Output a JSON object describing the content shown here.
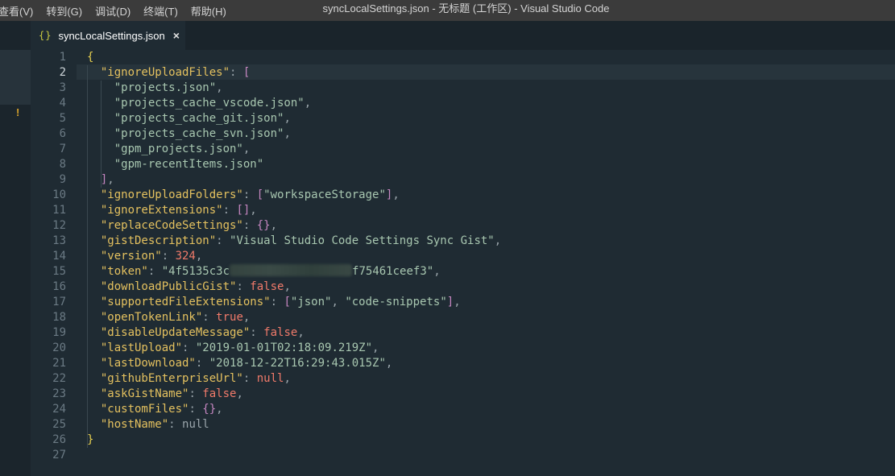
{
  "menu": [
    "查看(V)",
    "转到(G)",
    "调试(D)",
    "终端(T)",
    "帮助(H)"
  ],
  "window_title": "syncLocalSettings.json - 无标题 (工作区) - Visual Studio Code",
  "tab": {
    "icon": "{}",
    "label": "syncLocalSettings.json",
    "close": "×"
  },
  "sidebar": {
    "warning": "!"
  },
  "editor": {
    "active_line": 2,
    "lines": [
      {
        "num": "1",
        "tokens": [
          {
            "t": "{",
            "c": "y"
          }
        ]
      },
      {
        "num": "2",
        "tokens": [
          {
            "t": "  "
          },
          {
            "t": "\"ignoreUploadFiles\"",
            "c": "k"
          },
          {
            "t": ": ",
            "c": "p"
          },
          {
            "t": "[",
            "c": "b"
          }
        ]
      },
      {
        "num": "3",
        "tokens": [
          {
            "t": "    "
          },
          {
            "t": "\"projects.json\"",
            "c": "s"
          },
          {
            "t": ",",
            "c": "p"
          }
        ]
      },
      {
        "num": "4",
        "tokens": [
          {
            "t": "    "
          },
          {
            "t": "\"projects_cache_vscode.json\"",
            "c": "s"
          },
          {
            "t": ",",
            "c": "p"
          }
        ]
      },
      {
        "num": "5",
        "tokens": [
          {
            "t": "    "
          },
          {
            "t": "\"projects_cache_git.json\"",
            "c": "s"
          },
          {
            "t": ",",
            "c": "p"
          }
        ]
      },
      {
        "num": "6",
        "tokens": [
          {
            "t": "    "
          },
          {
            "t": "\"projects_cache_svn.json\"",
            "c": "s"
          },
          {
            "t": ",",
            "c": "p"
          }
        ]
      },
      {
        "num": "7",
        "tokens": [
          {
            "t": "    "
          },
          {
            "t": "\"gpm_projects.json\"",
            "c": "s"
          },
          {
            "t": ",",
            "c": "p"
          }
        ]
      },
      {
        "num": "8",
        "tokens": [
          {
            "t": "    "
          },
          {
            "t": "\"gpm-recentItems.json\"",
            "c": "s"
          }
        ]
      },
      {
        "num": "9",
        "tokens": [
          {
            "t": "  "
          },
          {
            "t": "]",
            "c": "b"
          },
          {
            "t": ",",
            "c": "p"
          }
        ]
      },
      {
        "num": "10",
        "tokens": [
          {
            "t": "  "
          },
          {
            "t": "\"ignoreUploadFolders\"",
            "c": "k"
          },
          {
            "t": ": ",
            "c": "p"
          },
          {
            "t": "[",
            "c": "b"
          },
          {
            "t": "\"workspaceStorage\"",
            "c": "s"
          },
          {
            "t": "]",
            "c": "b"
          },
          {
            "t": ",",
            "c": "p"
          }
        ]
      },
      {
        "num": "11",
        "tokens": [
          {
            "t": "  "
          },
          {
            "t": "\"ignoreExtensions\"",
            "c": "k"
          },
          {
            "t": ": ",
            "c": "p"
          },
          {
            "t": "[]",
            "c": "b"
          },
          {
            "t": ",",
            "c": "p"
          }
        ]
      },
      {
        "num": "12",
        "tokens": [
          {
            "t": "  "
          },
          {
            "t": "\"replaceCodeSettings\"",
            "c": "k"
          },
          {
            "t": ": ",
            "c": "p"
          },
          {
            "t": "{}",
            "c": "b"
          },
          {
            "t": ",",
            "c": "p"
          }
        ]
      },
      {
        "num": "13",
        "tokens": [
          {
            "t": "  "
          },
          {
            "t": "\"gistDescription\"",
            "c": "k"
          },
          {
            "t": ": ",
            "c": "p"
          },
          {
            "t": "\"Visual Studio Code Settings Sync Gist\"",
            "c": "s"
          },
          {
            "t": ",",
            "c": "p"
          }
        ]
      },
      {
        "num": "14",
        "tokens": [
          {
            "t": "  "
          },
          {
            "t": "\"version\"",
            "c": "k"
          },
          {
            "t": ": ",
            "c": "p"
          },
          {
            "t": "324",
            "c": "n"
          },
          {
            "t": ",",
            "c": "p"
          }
        ]
      },
      {
        "num": "15",
        "tokens": [
          {
            "t": "  "
          },
          {
            "t": "\"token\"",
            "c": "k"
          },
          {
            "t": ": ",
            "c": "p"
          },
          {
            "t": "\"4f5135c3c",
            "c": "s"
          },
          {
            "t": "",
            "blur": true
          },
          {
            "t": "f75461ceef3\"",
            "c": "s"
          },
          {
            "t": ",",
            "c": "p"
          }
        ]
      },
      {
        "num": "16",
        "tokens": [
          {
            "t": "  "
          },
          {
            "t": "\"downloadPublicGist\"",
            "c": "k"
          },
          {
            "t": ": ",
            "c": "p"
          },
          {
            "t": "false",
            "c": "n"
          },
          {
            "t": ",",
            "c": "p"
          }
        ]
      },
      {
        "num": "17",
        "tokens": [
          {
            "t": "  "
          },
          {
            "t": "\"supportedFileExtensions\"",
            "c": "k"
          },
          {
            "t": ": ",
            "c": "p"
          },
          {
            "t": "[",
            "c": "b"
          },
          {
            "t": "\"json\"",
            "c": "s"
          },
          {
            "t": ", ",
            "c": "p"
          },
          {
            "t": "\"code-snippets\"",
            "c": "s"
          },
          {
            "t": "]",
            "c": "b"
          },
          {
            "t": ",",
            "c": "p"
          }
        ]
      },
      {
        "num": "18",
        "tokens": [
          {
            "t": "  "
          },
          {
            "t": "\"openTokenLink\"",
            "c": "k"
          },
          {
            "t": ": ",
            "c": "p"
          },
          {
            "t": "true",
            "c": "n"
          },
          {
            "t": ",",
            "c": "p"
          }
        ]
      },
      {
        "num": "19",
        "tokens": [
          {
            "t": "  "
          },
          {
            "t": "\"disableUpdateMessage\"",
            "c": "k"
          },
          {
            "t": ": ",
            "c": "p"
          },
          {
            "t": "false",
            "c": "n"
          },
          {
            "t": ",",
            "c": "p"
          }
        ]
      },
      {
        "num": "20",
        "tokens": [
          {
            "t": "  "
          },
          {
            "t": "\"lastUpload\"",
            "c": "k"
          },
          {
            "t": ": ",
            "c": "p"
          },
          {
            "t": "\"2019-01-01T02:18:09.219Z\"",
            "c": "s"
          },
          {
            "t": ",",
            "c": "p"
          }
        ]
      },
      {
        "num": "21",
        "tokens": [
          {
            "t": "  "
          },
          {
            "t": "\"lastDownload\"",
            "c": "k"
          },
          {
            "t": ": ",
            "c": "p"
          },
          {
            "t": "\"2018-12-22T16:29:43.015Z\"",
            "c": "s"
          },
          {
            "t": ",",
            "c": "p"
          }
        ]
      },
      {
        "num": "22",
        "tokens": [
          {
            "t": "  "
          },
          {
            "t": "\"githubEnterpriseUrl\"",
            "c": "k"
          },
          {
            "t": ": ",
            "c": "p"
          },
          {
            "t": "null",
            "c": "n"
          },
          {
            "t": ",",
            "c": "p"
          }
        ]
      },
      {
        "num": "23",
        "tokens": [
          {
            "t": "  "
          },
          {
            "t": "\"askGistName\"",
            "c": "k"
          },
          {
            "t": ": ",
            "c": "p"
          },
          {
            "t": "false",
            "c": "n"
          },
          {
            "t": ",",
            "c": "p"
          }
        ]
      },
      {
        "num": "24",
        "tokens": [
          {
            "t": "  "
          },
          {
            "t": "\"customFiles\"",
            "c": "k"
          },
          {
            "t": ": ",
            "c": "p"
          },
          {
            "t": "{}",
            "c": "b"
          },
          {
            "t": ",",
            "c": "p"
          }
        ]
      },
      {
        "num": "25",
        "tokens": [
          {
            "t": "  "
          },
          {
            "t": "\"hostName\"",
            "c": "k"
          },
          {
            "t": ": ",
            "c": "p"
          },
          {
            "t": "null",
            "c": "p"
          }
        ]
      },
      {
        "num": "26",
        "tokens": [
          {
            "t": "}",
            "c": "y"
          }
        ]
      },
      {
        "num": "27",
        "tokens": []
      }
    ]
  }
}
